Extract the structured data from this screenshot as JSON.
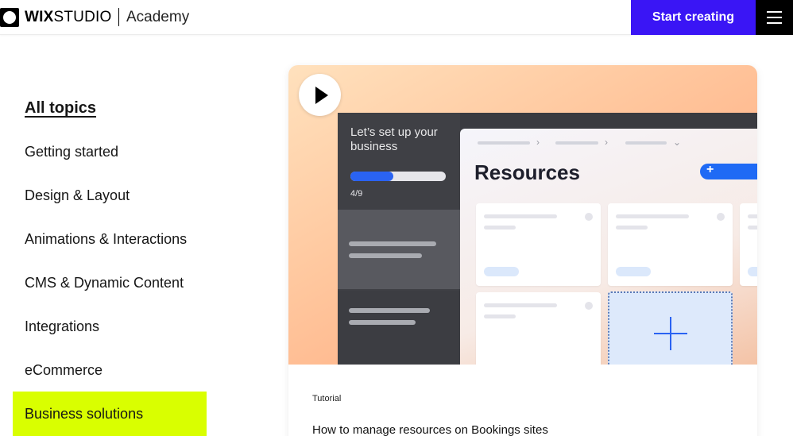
{
  "header": {
    "brand_wix": "WIX",
    "brand_studio": "STUDIO",
    "section": "Academy",
    "cta_label": "Start creating"
  },
  "sidebar": {
    "items": [
      {
        "label": "All topics",
        "active": true
      },
      {
        "label": "Getting started"
      },
      {
        "label": "Design & Layout"
      },
      {
        "label": "Animations & Interactions"
      },
      {
        "label": "CMS & Dynamic Content"
      },
      {
        "label": "Integrations"
      },
      {
        "label": "eCommerce"
      },
      {
        "label": "Business solutions",
        "highlighted": true
      }
    ]
  },
  "card": {
    "thumbnail": {
      "onboarding_question": "Let’s set up your business",
      "progress_value": 0.45,
      "progress_step": "4/9",
      "panel_title": "Resources"
    },
    "label": "Tutorial",
    "title": "How to manage resources on Bookings sites"
  },
  "colors": {
    "cta": "#3a15f5",
    "highlight": "#d9ff00",
    "accent_blue": "#1f6af5"
  },
  "icons": [
    "logo-icon",
    "menu-icon",
    "play-icon",
    "plus-icon"
  ]
}
